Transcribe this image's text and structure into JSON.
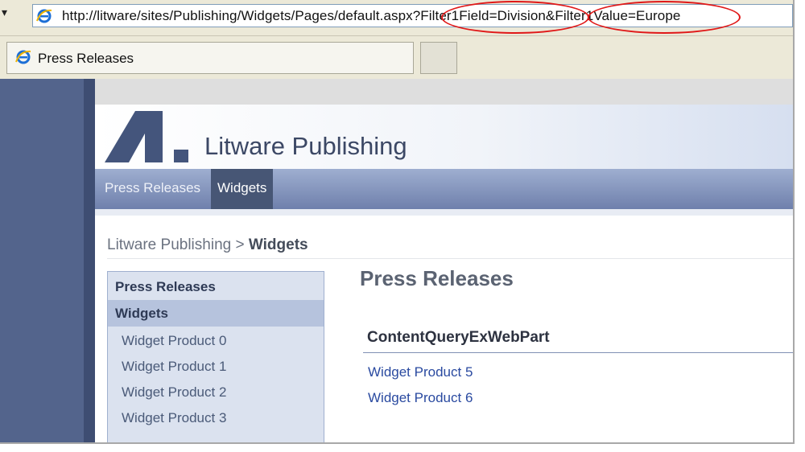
{
  "browser": {
    "address_url": "http://litware/sites/Publishing/Widgets/Pages/default.aspx?Filter1Field=Division&Filter1Value=Europe",
    "address_highlights": [
      "Filter1Field=Division",
      "Filter1Value=Europe"
    ],
    "tab_title": "Press Releases"
  },
  "site": {
    "title": "Litware Publishing",
    "nav": [
      "Press Releases",
      "Widgets"
    ],
    "nav_selected": "Widgets"
  },
  "breadcrumb": {
    "root": "Litware Publishing",
    "separator": ">",
    "current": "Widgets"
  },
  "quick_launch": {
    "headings": [
      "Press Releases",
      "Widgets"
    ],
    "items": [
      "Widget Product 0",
      "Widget Product 1",
      "Widget Product 2",
      "Widget Product 3"
    ]
  },
  "content": {
    "page_title": "Press Releases",
    "webpart_title": "ContentQueryExWebPart",
    "links": [
      "Widget Product 5",
      "Widget Product 6"
    ]
  },
  "colors": {
    "highlight_ring": "#e01818",
    "nav_selected": "#475675",
    "link": "#2a4aa0"
  },
  "icons": [
    "ie-logo-icon",
    "dropdown-arrow-icon",
    "litware-logo"
  ]
}
